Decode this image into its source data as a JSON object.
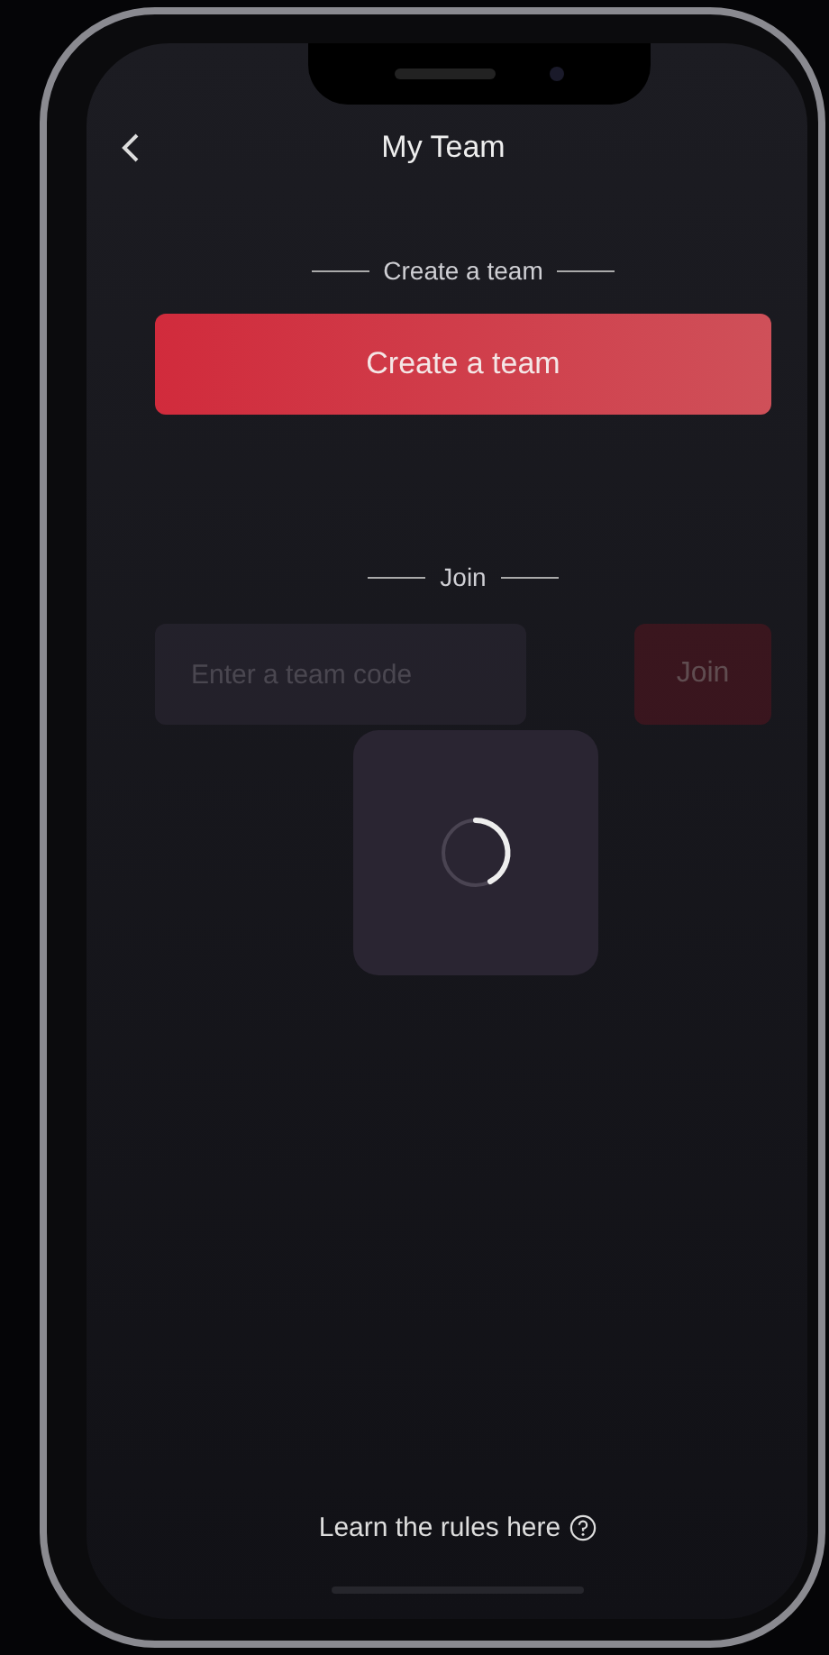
{
  "header": {
    "title": "My Team"
  },
  "create_section": {
    "label": "Create a team",
    "button": "Create a team"
  },
  "join_section": {
    "label": "Join",
    "placeholder": "Enter a team code",
    "button": "Join"
  },
  "loading": true,
  "footer": {
    "link": "Learn the rules here"
  }
}
